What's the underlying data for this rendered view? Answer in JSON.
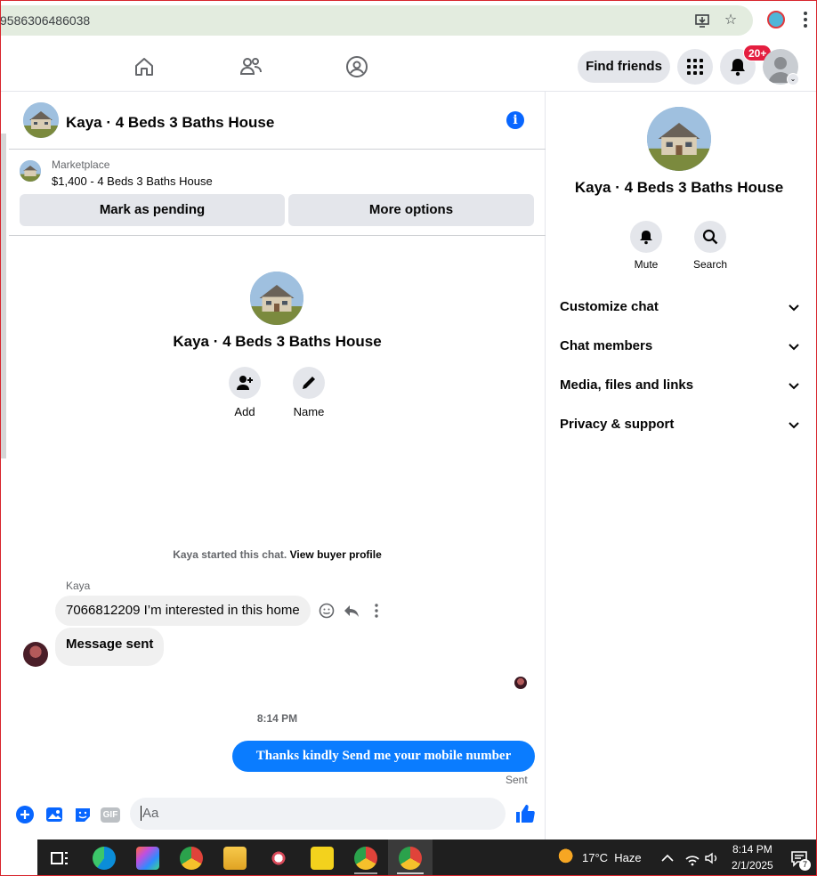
{
  "browser": {
    "url_fragment": "9586306486038"
  },
  "fb_nav": {
    "home_icon": "home-icon",
    "friends_icon": "friends-icon",
    "groups_icon": "groups-icon",
    "find_friends": "Find friends",
    "notification_count": "20+"
  },
  "chat": {
    "title": "Kaya · 4 Beds 3 Baths House",
    "marketplace_label": "Marketplace",
    "listing": "$1,400 - 4 Beds 3 Baths House",
    "mark_pending": "Mark as pending",
    "more_options": "More options",
    "center_title": "Kaya · 4 Beds 3 Baths House",
    "add_label": "Add",
    "name_label": "Name",
    "system_msg_prefix": "Kaya started this chat.",
    "system_msg_link": "View buyer profile",
    "sender_name": "Kaya",
    "incoming": [
      "7066812209 I’m interested in this home",
      "Message sent"
    ],
    "timestamp": "8:14 PM",
    "outgoing": "Thanks kindly Send me your mobile number",
    "outgoing_status": "Sent",
    "composer_placeholder": "Aa",
    "gif_label": "GIF"
  },
  "info_panel": {
    "title": "Kaya · 4 Beds 3 Baths House",
    "mute": "Mute",
    "search": "Search",
    "sections": [
      "Customize chat",
      "Chat members",
      "Media, files and links",
      "Privacy & support"
    ]
  },
  "taskbar": {
    "weather": "17°C  Haze",
    "time": "8:14 PM",
    "date": "2/1/2025",
    "notif_count": "7"
  },
  "colors": {
    "accent": "#0866ff",
    "bubble_out": "#0a7cff",
    "badge": "#e41e3f"
  }
}
